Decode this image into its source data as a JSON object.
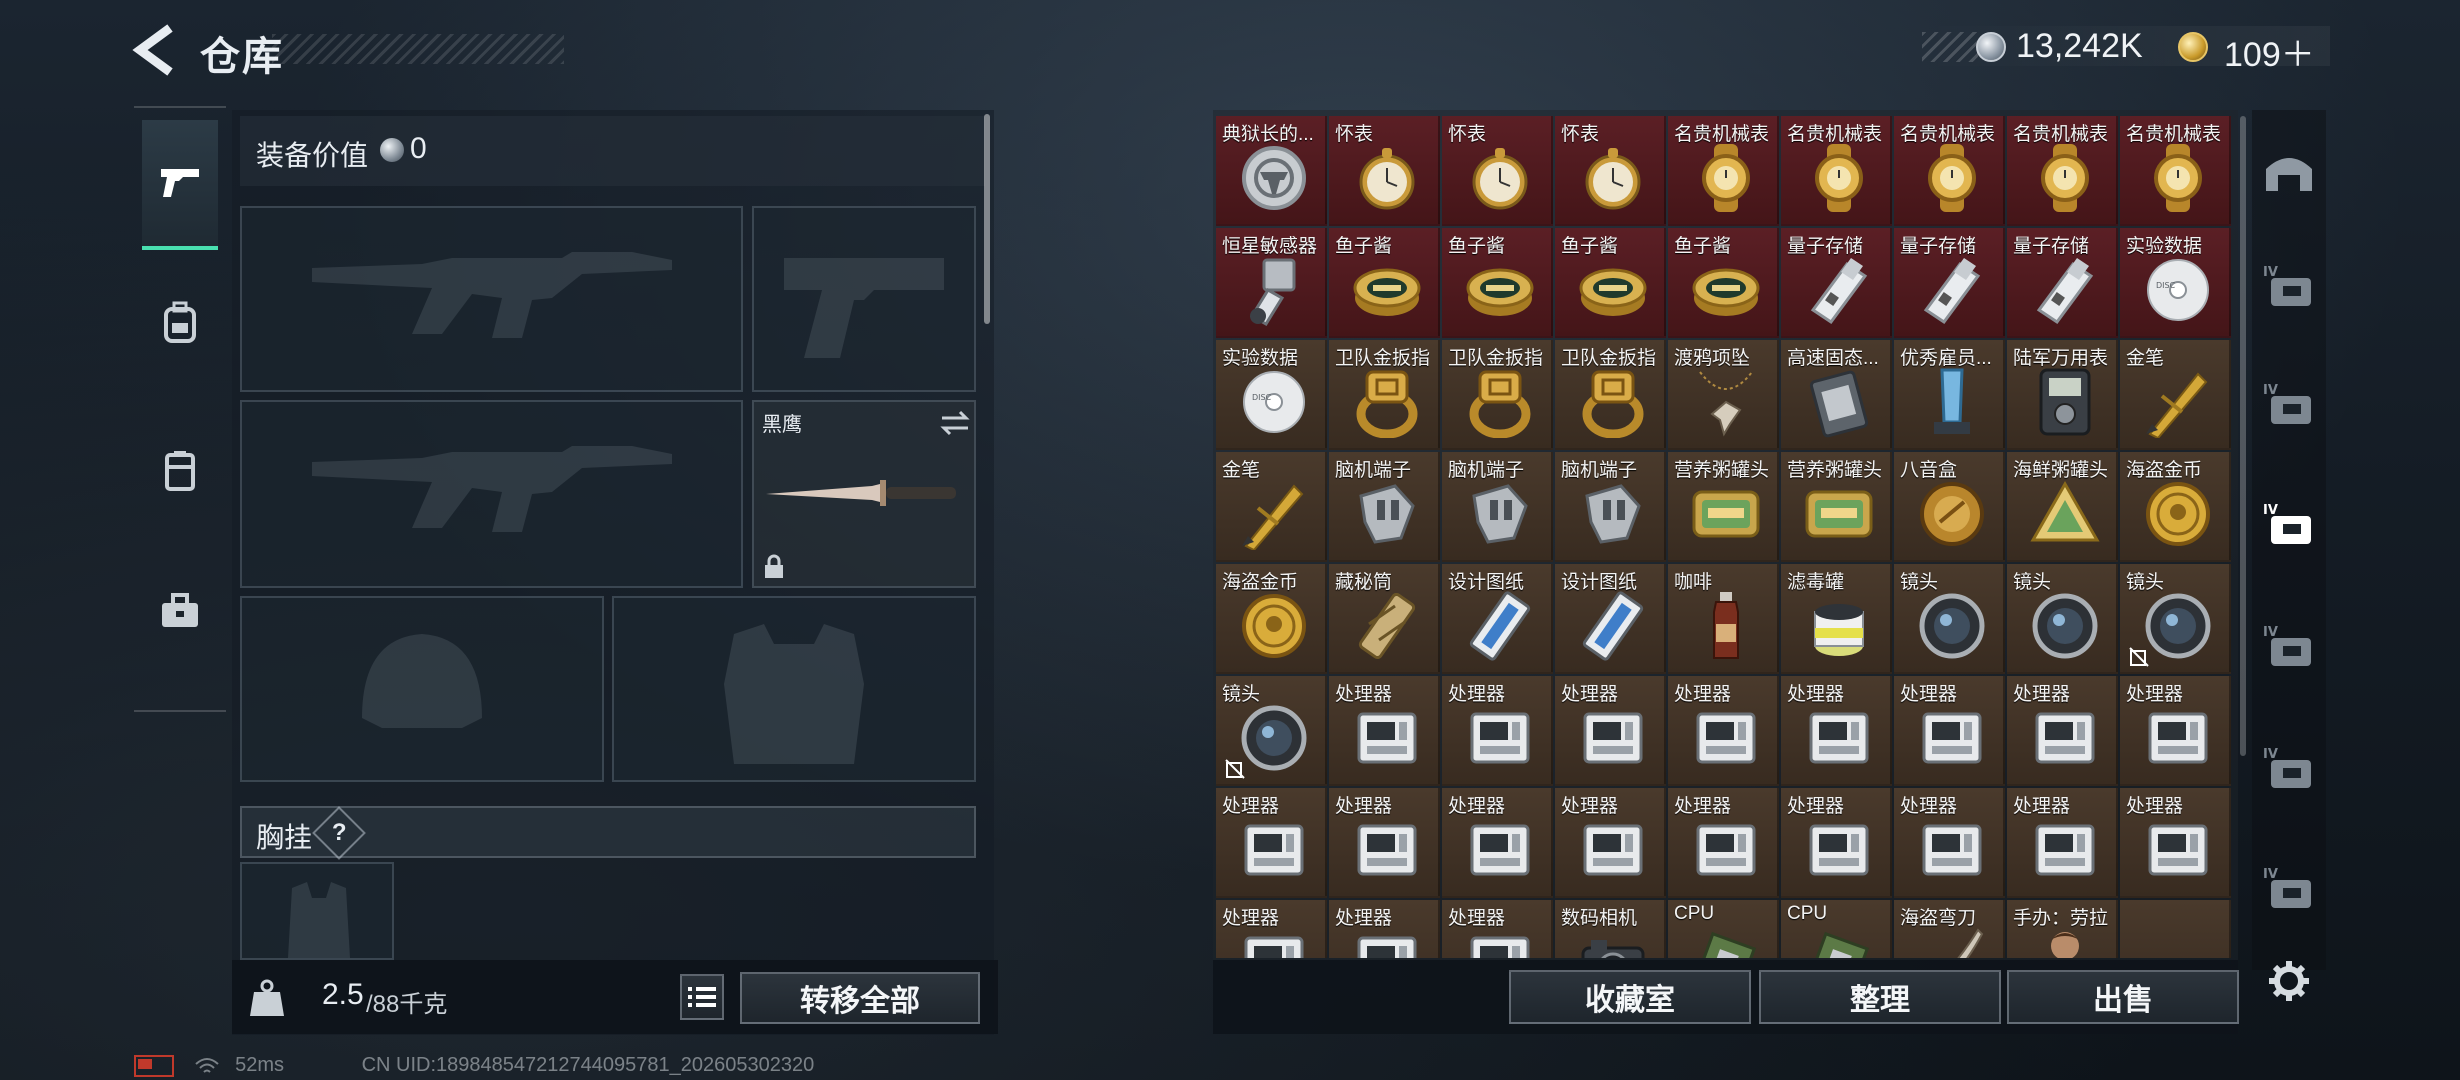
{
  "header": {
    "title": "仓库",
    "currency_silver": "13,242K",
    "currency_gold": "109＋"
  },
  "left_tabs": [
    "pistol-icon",
    "backpack-icon",
    "vest-icon",
    "toolbox-icon"
  ],
  "equipment": {
    "value_label": "装备价值",
    "value": "0",
    "melee_name": "黑鹰",
    "chest_label": "胸挂",
    "chest_help": "?"
  },
  "bottom_left": {
    "weight_current": "2.5",
    "weight_max": "/88千克",
    "transfer_all": "转移全部"
  },
  "inventory": {
    "rows": [
      [
        {
          "n": "典狱长的...",
          "c": "red",
          "i": "badge"
        },
        {
          "n": "怀表",
          "c": "red",
          "i": "watch"
        },
        {
          "n": "怀表",
          "c": "red",
          "i": "watch"
        },
        {
          "n": "怀表",
          "c": "red",
          "i": "watch"
        },
        {
          "n": "名贵机械表",
          "c": "red",
          "i": "gold"
        },
        {
          "n": "名贵机械表",
          "c": "red",
          "i": "gold"
        },
        {
          "n": "名贵机械表",
          "c": "red",
          "i": "gold"
        },
        {
          "n": "名贵机械表",
          "c": "red",
          "i": "gold"
        },
        {
          "n": "名贵机械表",
          "c": "red",
          "i": "gold"
        }
      ],
      [
        {
          "n": "恒星敏感器",
          "c": "red",
          "i": "device"
        },
        {
          "n": "鱼子酱",
          "c": "red",
          "i": "tin"
        },
        {
          "n": "鱼子酱",
          "c": "red",
          "i": "tin"
        },
        {
          "n": "鱼子酱",
          "c": "red",
          "i": "tin"
        },
        {
          "n": "鱼子酱",
          "c": "red",
          "i": "tin"
        },
        {
          "n": "量子存储",
          "c": "red",
          "i": "usb"
        },
        {
          "n": "量子存储",
          "c": "red",
          "i": "usb"
        },
        {
          "n": "量子存储",
          "c": "red",
          "i": "usb"
        },
        {
          "n": "实验数据",
          "c": "red",
          "i": "disc"
        }
      ],
      [
        {
          "n": "实验数据",
          "c": "brown",
          "i": "disc"
        },
        {
          "n": "卫队金扳指",
          "c": "brown",
          "i": "ring"
        },
        {
          "n": "卫队金扳指",
          "c": "brown",
          "i": "ring"
        },
        {
          "n": "卫队金扳指",
          "c": "brown",
          "i": "ring"
        },
        {
          "n": "渡鸦项坠",
          "c": "brown",
          "i": "pendant"
        },
        {
          "n": "高速固态...",
          "c": "brown",
          "i": "card"
        },
        {
          "n": "优秀雇员...",
          "c": "brown",
          "i": "trophy"
        },
        {
          "n": "陆军万用表",
          "c": "brown",
          "i": "meter"
        },
        {
          "n": "金笔",
          "c": "brown",
          "i": "pen"
        }
      ],
      [
        {
          "n": "金笔",
          "c": "brown",
          "i": "pen"
        },
        {
          "n": "脑机端子",
          "c": "brown",
          "i": "plug"
        },
        {
          "n": "脑机端子",
          "c": "brown",
          "i": "plug"
        },
        {
          "n": "脑机端子",
          "c": "brown",
          "i": "plug"
        },
        {
          "n": "营养粥罐头",
          "c": "brown",
          "i": "can"
        },
        {
          "n": "营养粥罐头",
          "c": "brown",
          "i": "can"
        },
        {
          "n": "八音盒",
          "c": "brown",
          "i": "musicbox"
        },
        {
          "n": "海鲜粥罐头",
          "c": "brown",
          "i": "triangle"
        },
        {
          "n": "海盗金币",
          "c": "brown",
          "i": "coin"
        }
      ],
      [
        {
          "n": "海盗金币",
          "c": "brown",
          "i": "coin"
        },
        {
          "n": "藏秘筒",
          "c": "brown",
          "i": "cylinder"
        },
        {
          "n": "设计图纸",
          "c": "brown",
          "i": "blueprint"
        },
        {
          "n": "设计图纸",
          "c": "brown",
          "i": "blueprint"
        },
        {
          "n": "咖啡",
          "c": "brown",
          "i": "bottle"
        },
        {
          "n": "滤毒罐",
          "c": "brown",
          "i": "filter"
        },
        {
          "n": "镜头",
          "c": "brown",
          "i": "lens"
        },
        {
          "n": "镜头",
          "c": "brown",
          "i": "lens"
        },
        {
          "n": "镜头",
          "c": "brown",
          "i": "lens",
          "badge": true
        }
      ],
      [
        {
          "n": "镜头",
          "c": "brown",
          "i": "lens",
          "badge": true
        },
        {
          "n": "处理器",
          "c": "brown",
          "i": "cpu"
        },
        {
          "n": "处理器",
          "c": "brown",
          "i": "cpu"
        },
        {
          "n": "处理器",
          "c": "brown",
          "i": "cpu"
        },
        {
          "n": "处理器",
          "c": "brown",
          "i": "cpu"
        },
        {
          "n": "处理器",
          "c": "brown",
          "i": "cpu"
        },
        {
          "n": "处理器",
          "c": "brown",
          "i": "cpu"
        },
        {
          "n": "处理器",
          "c": "brown",
          "i": "cpu"
        },
        {
          "n": "处理器",
          "c": "brown",
          "i": "cpu"
        }
      ],
      [
        {
          "n": "处理器",
          "c": "brown",
          "i": "cpu"
        },
        {
          "n": "处理器",
          "c": "brown",
          "i": "cpu"
        },
        {
          "n": "处理器",
          "c": "brown",
          "i": "cpu"
        },
        {
          "n": "处理器",
          "c": "brown",
          "i": "cpu"
        },
        {
          "n": "处理器",
          "c": "brown",
          "i": "cpu"
        },
        {
          "n": "处理器",
          "c": "brown",
          "i": "cpu"
        },
        {
          "n": "处理器",
          "c": "brown",
          "i": "cpu"
        },
        {
          "n": "处理器",
          "c": "brown",
          "i": "cpu"
        },
        {
          "n": "处理器",
          "c": "brown",
          "i": "cpu"
        }
      ],
      [
        {
          "n": "处理器",
          "c": "brown",
          "i": "cpu"
        },
        {
          "n": "处理器",
          "c": "brown",
          "i": "cpu"
        },
        {
          "n": "处理器",
          "c": "brown",
          "i": "cpu"
        },
        {
          "n": "数码相机",
          "c": "brown",
          "i": "camera"
        },
        {
          "n": "CPU",
          "c": "brown",
          "i": "chip"
        },
        {
          "n": "CPU",
          "c": "brown",
          "i": "chip"
        },
        {
          "n": "海盗弯刀",
          "c": "brown",
          "i": "sword"
        },
        {
          "n": "手办：劳拉",
          "c": "brown",
          "i": "figure"
        },
        {
          "n": "",
          "c": "brown",
          "i": "none"
        }
      ]
    ]
  },
  "right_rail": [
    "home-icon",
    "iv-key-icon-1",
    "iv-key-icon-2",
    "iv-key-icon-3",
    "iv-folder-icon",
    "iv-triangle-icon",
    "iv-add-icon",
    "settings-icon"
  ],
  "bottom_right": {
    "collection": "收藏室",
    "organize": "整理",
    "sell": "出售"
  },
  "status": {
    "ping": "52ms",
    "uid": "CN UID:189848547212744095781_202605302320"
  },
  "colors": {
    "accent": "#49e0b0",
    "rare_red": "#5b1f25",
    "rare_brown": "#4a3a2c"
  }
}
